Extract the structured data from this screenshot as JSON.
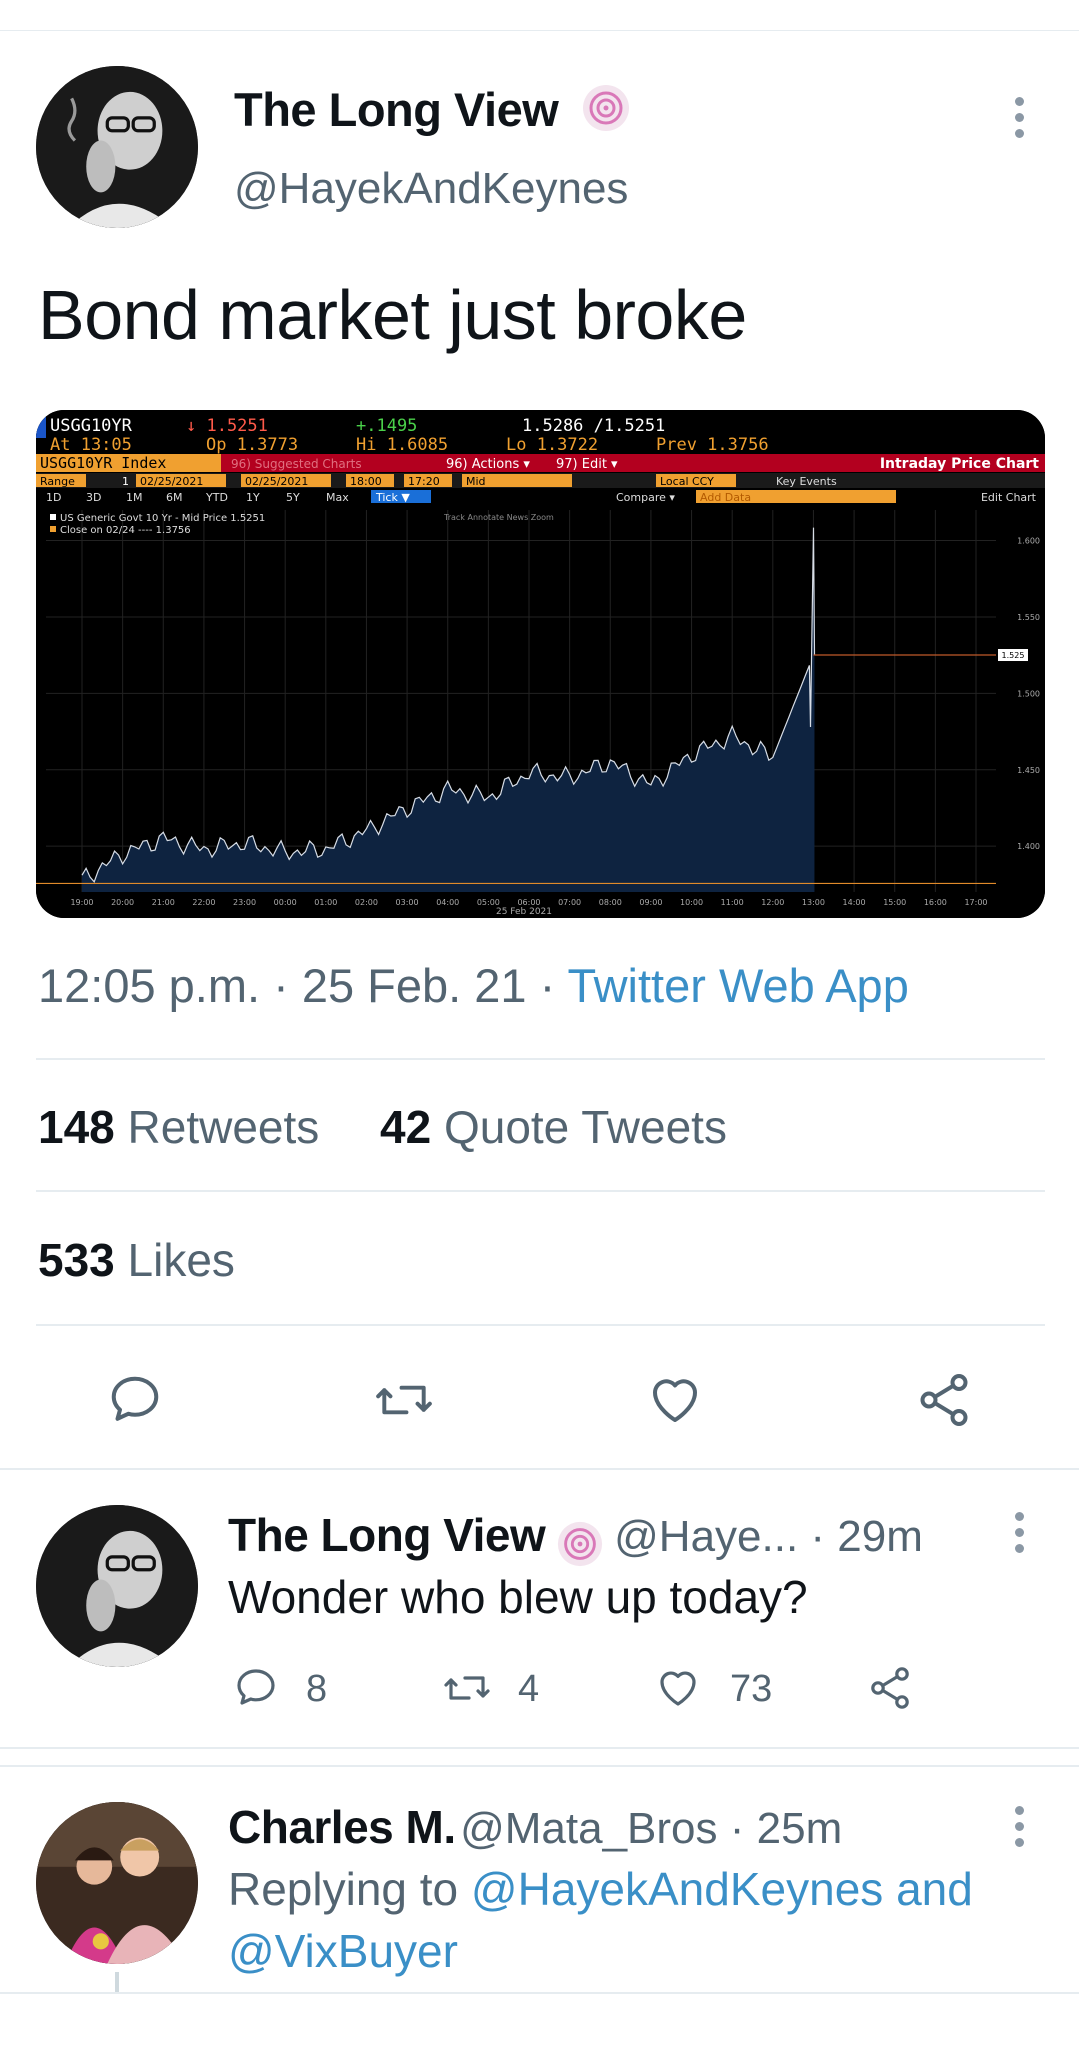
{
  "main_tweet": {
    "name": "The Long View",
    "handle": "@HayekAndKeynes",
    "text": "Bond market just broke",
    "timestamp": "12:05 p.m. · 25 Feb. 21 · ",
    "source_app": "Twitter Web App",
    "retweets_count": "148",
    "retweets_label": "Retweets",
    "quotes_count": "42",
    "quotes_label": "Quote Tweets",
    "likes_count": "533",
    "likes_label": "Likes"
  },
  "terminal": {
    "ticker": "USGG10YR",
    "last": "↓ 1.5251",
    "change": "+.1495",
    "bidask": "1.5286 /1.5251",
    "time": "At 13:05",
    "open": "Op 1.3773",
    "high": "Hi 1.6085",
    "low": "Lo 1.3722",
    "prev": "Prev  1.3756",
    "index_label": "USGG10YR Index",
    "suggested": "96) Suggested Charts",
    "actions": "96) Actions ▾",
    "edit": "97) Edit ▾",
    "chart_title": "Intraday Price Chart",
    "range_label": "Range",
    "range_val": "1",
    "date_from": "02/25/2021",
    "date_to": "02/25/2021",
    "time_from": "18:00",
    "time_to": "17:20",
    "mid": "Mid",
    "ccy": "Local CCY",
    "key_events": "Key Events",
    "periods": [
      "1D",
      "3D",
      "1M",
      "6M",
      "YTD",
      "1Y",
      "5Y",
      "Max"
    ],
    "tick": "Tick ▼",
    "compare": "Compare ▾",
    "add_data": "Add Data",
    "edit_chart": "Edit Chart",
    "tools": "Track   Annotate   News   Zoom",
    "legend_1": "US Generic Govt 10 Yr - Mid Price 1.5251",
    "legend_2": "Close on 02/24 ----                    1.3756",
    "date_label": "25 Feb 2021",
    "price_badge": "1.525"
  },
  "chart_data": {
    "type": "area",
    "title": "",
    "xlabel": "",
    "ylabel": "",
    "x": [
      "19:00",
      "20:00",
      "21:00",
      "22:00",
      "23:00",
      "00:00",
      "01:00",
      "02:00",
      "03:00",
      "04:00",
      "05:00",
      "06:00",
      "07:00",
      "08:00",
      "09:00",
      "10:00",
      "11:00",
      "12:00",
      "13:00"
    ],
    "x_ticks": [
      "19:00",
      "20:00",
      "21:00",
      "22:00",
      "23:00",
      "00:00",
      "01:00",
      "02:00",
      "03:00",
      "04:00",
      "05:00",
      "06:00",
      "07:00",
      "08:00",
      "09:00",
      "10:00",
      "11:00",
      "12:00",
      "13:00",
      "14:00",
      "15:00",
      "16:00",
      "17:00"
    ],
    "y_ticks": [
      "1.600",
      "1.550",
      "1.500",
      "1.450",
      "1.400"
    ],
    "ylim": [
      1.37,
      1.62
    ],
    "series": [
      {
        "values": [
          1.378,
          1.395,
          1.405,
          1.398,
          1.402,
          1.396,
          1.398,
          1.41,
          1.425,
          1.437,
          1.432,
          1.448,
          1.445,
          1.455,
          1.44,
          1.46,
          1.472,
          1.458,
          1.525
        ]
      }
    ],
    "spike_high": 1.6085,
    "last_price": 1.5251,
    "prev_close": 1.3756,
    "colors": {
      "area": "#0e2340",
      "line": "#d7dde6",
      "prev_close": "#e08a2a",
      "last": "#c05a2a"
    }
  },
  "reply_1": {
    "name": "The Long View",
    "handle": "@Haye...",
    "age": " · 29m",
    "text": "Wonder who blew up today?",
    "replies": "8",
    "retweets": "4",
    "likes": "73"
  },
  "reply_2": {
    "name": "Charles M.",
    "handle": "@Mata_Bros",
    "age": " · 25m",
    "replying_prefix": "Replying to ",
    "replying_users": "@HayekAndKeynes and",
    "replying_users_2": "@VixBuyer"
  },
  "colors": {
    "link": "#3a8fc7",
    "muted": "#536471",
    "text": "#0f1419",
    "verified": "#d978b8"
  }
}
